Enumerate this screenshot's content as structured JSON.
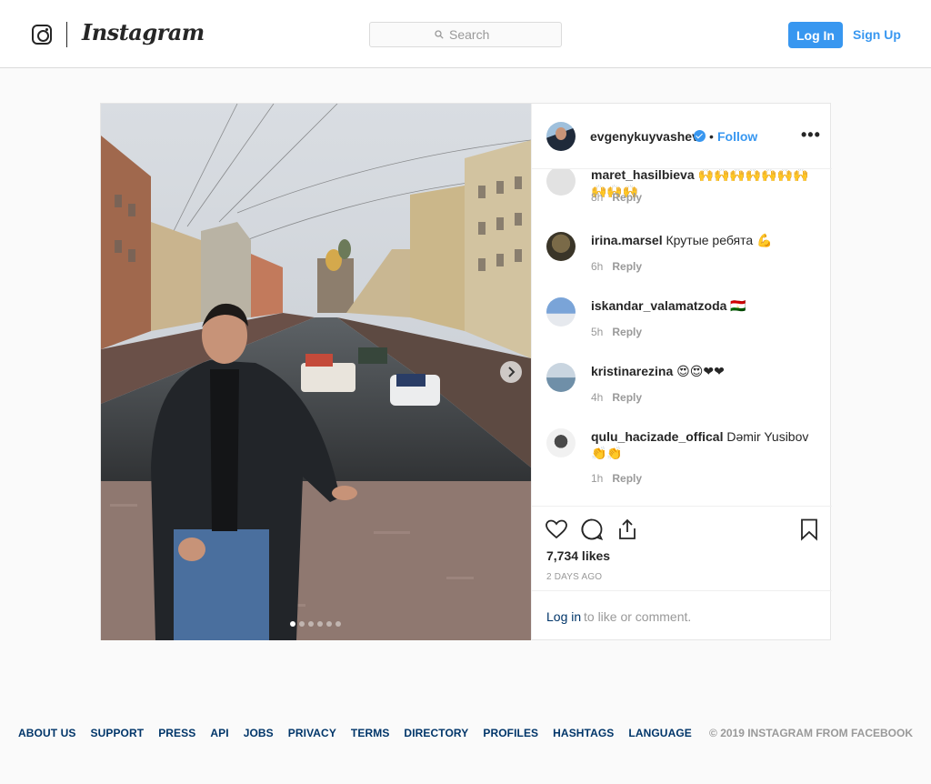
{
  "header": {
    "wordmark": "Instagram",
    "search_placeholder": "Search",
    "login_label": "Log In",
    "signup_label": "Sign Up"
  },
  "post": {
    "username": "evgenykuyvashev",
    "bullet": "•",
    "follow_label": "Follow",
    "more_label": "•••",
    "likes": "7,734 likes",
    "posted_ago": "2 DAYS AGO",
    "carousel_count": 6,
    "carousel_active": 1,
    "login_prompt_link": "Log in",
    "login_prompt_rest": " to like or comment."
  },
  "comments": [
    {
      "user": "maret_hasilbieva",
      "text": "🙌🙌🙌🙌🙌🙌🙌🙌🙌🙌",
      "time": "8h",
      "reply": "Reply"
    },
    {
      "user": "irina.marsel",
      "text": "Крутые ребята 💪",
      "time": "6h",
      "reply": "Reply"
    },
    {
      "user": "iskandar_valamatzoda",
      "text": "🇹🇯",
      "time": "5h",
      "reply": "Reply"
    },
    {
      "user": "kristinarezina",
      "text": "😍😍❤❤",
      "time": "4h",
      "reply": "Reply"
    },
    {
      "user": "qulu_hacizade_offical",
      "text": "Dəmir Yusibov",
      "text2": "👏👏",
      "time": "1h",
      "reply": "Reply"
    }
  ],
  "footer": {
    "links": [
      "ABOUT US",
      "SUPPORT",
      "PRESS",
      "API",
      "JOBS",
      "PRIVACY",
      "TERMS",
      "DIRECTORY",
      "PROFILES",
      "HASHTAGS",
      "LANGUAGE"
    ],
    "copyright": "© 2019 INSTAGRAM FROM FACEBOOK"
  },
  "colors": {
    "accent": "#3897f0",
    "link_dark": "#003569",
    "muted": "#999999",
    "border": "#dbdbdb"
  }
}
